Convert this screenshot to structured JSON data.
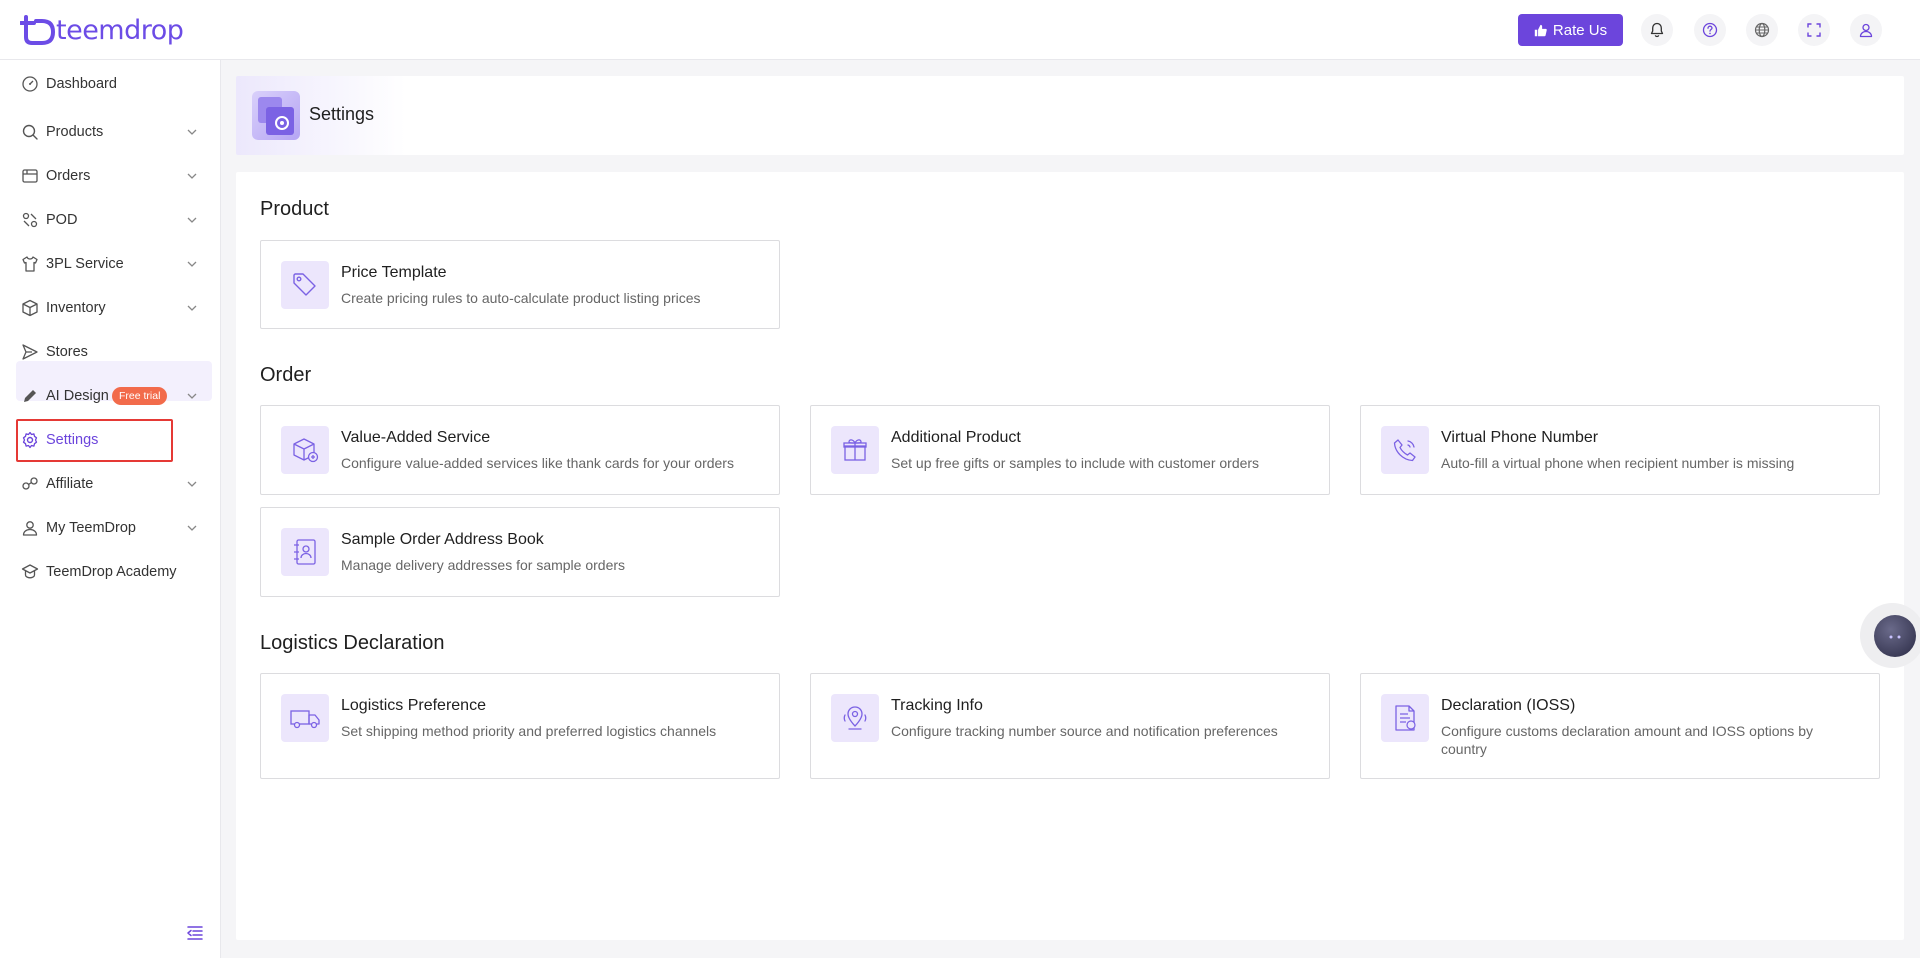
{
  "header": {
    "logo_text": "teemdrop",
    "rate_label": "Rate Us",
    "icons": [
      "bell-icon",
      "help-icon",
      "globe-icon",
      "fullscreen-icon",
      "user-icon"
    ]
  },
  "sidebar": {
    "items": [
      {
        "label": "Dashboard",
        "icon": "dashboard-icon"
      },
      {
        "label": "Products",
        "icon": "search-icon"
      },
      {
        "label": "Orders",
        "icon": "orders-icon"
      },
      {
        "label": "POD",
        "icon": "pod-icon"
      },
      {
        "label": "3PL Service",
        "icon": "shirt-icon"
      },
      {
        "label": "Inventory",
        "icon": "box-icon"
      },
      {
        "label": "Stores",
        "icon": "send-icon"
      },
      {
        "label": "AI Design",
        "icon": "pen-icon",
        "badge": "Free trial"
      },
      {
        "label": "Settings",
        "icon": "gear-icon"
      },
      {
        "label": "Affiliate",
        "icon": "affiliate-icon"
      },
      {
        "label": "My TeemDrop",
        "icon": "user-icon"
      },
      {
        "label": "TeemDrop Academy",
        "icon": "academy-icon"
      }
    ]
  },
  "page": {
    "title": "Settings"
  },
  "sections": {
    "product": {
      "title": "Product",
      "cards": [
        {
          "title": "Price Template",
          "desc": "Create pricing rules to auto-calculate product listing prices",
          "icon": "price-tag-icon"
        }
      ]
    },
    "order": {
      "title": "Order",
      "cards": [
        {
          "title": "Value-Added Service",
          "desc": "Configure value-added services like thank cards for your orders",
          "icon": "package-plus-icon"
        },
        {
          "title": "Additional Product",
          "desc": "Set up free gifts or samples to include with customer orders",
          "icon": "gift-icon"
        },
        {
          "title": "Virtual Phone Number",
          "desc": "Auto-fill a virtual phone when recipient number is missing",
          "icon": "phone-icon"
        },
        {
          "title": "Sample Order Address Book",
          "desc": "Manage delivery addresses for sample orders",
          "icon": "address-book-icon"
        }
      ]
    },
    "logistics": {
      "title": "Logistics Declaration",
      "cards": [
        {
          "title": "Logistics Preference",
          "desc": "Set shipping method priority and preferred logistics channels",
          "icon": "truck-icon"
        },
        {
          "title": "Tracking Info",
          "desc": "Configure tracking number source and notification preferences",
          "icon": "location-pin-icon"
        },
        {
          "title": "Declaration (IOSS)",
          "desc": "Configure customs declaration amount and IOSS options by country",
          "icon": "document-icon"
        }
      ]
    }
  },
  "colors": {
    "accent": "#6c45dc",
    "badge": "#f26b4b",
    "highlight_box": "#e53935"
  }
}
